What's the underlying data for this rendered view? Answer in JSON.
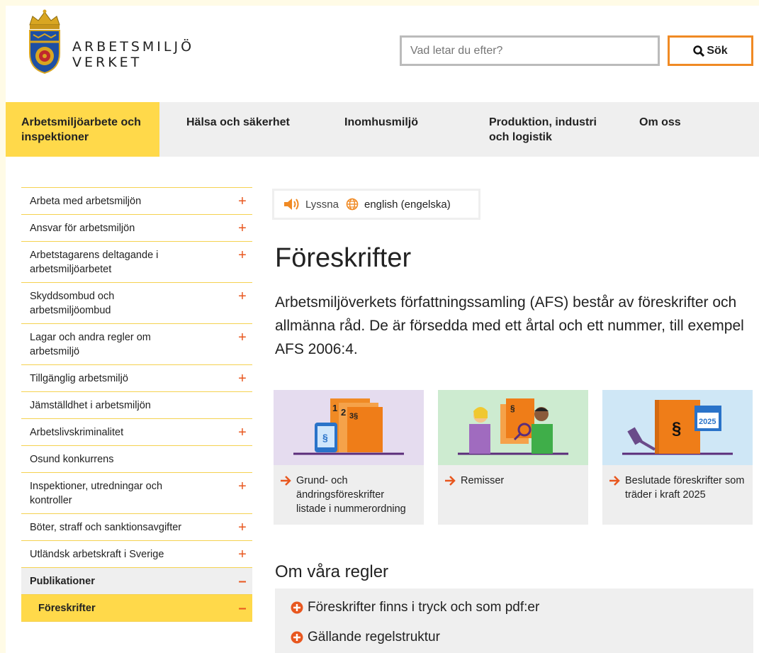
{
  "logo": {
    "line1": "ARBETSMILJÖ",
    "line2": "VERKET",
    "icon": "coat-of-arms-icon"
  },
  "search": {
    "placeholder": "Vad letar du efter?",
    "button_label": "Sök"
  },
  "nav": [
    {
      "label": "Arbetsmiljöarbete och inspektioner",
      "active": true
    },
    {
      "label": "Hälsa och säkerhet"
    },
    {
      "label": "Inomhusmiljö"
    },
    {
      "label": "Produktion, industri och logistik"
    },
    {
      "label": "Om oss"
    }
  ],
  "sidebar": [
    {
      "label": "Arbeta med arbetsmiljön",
      "sign": "+"
    },
    {
      "label": "Ansvar för arbetsmiljön",
      "sign": "+"
    },
    {
      "label": "Arbetstagarens deltagande i arbetsmiljöarbetet",
      "sign": "+"
    },
    {
      "label": "Skyddsombud och arbetsmiljöombud",
      "sign": "+"
    },
    {
      "label": "Lagar och andra regler om arbetsmiljö",
      "sign": "+"
    },
    {
      "label": "Tillgänglig arbetsmiljö",
      "sign": "+"
    },
    {
      "label": "Jämställdhet i arbetsmiljön",
      "sign": ""
    },
    {
      "label": "Arbetslivskriminalitet",
      "sign": "+"
    },
    {
      "label": "Osund konkurrens",
      "sign": ""
    },
    {
      "label": "Inspektioner, utredningar och kontroller",
      "sign": "+"
    },
    {
      "label": "Böter, straff och sanktionsavgifter",
      "sign": "+"
    },
    {
      "label": "Utländsk arbetskraft i Sverige",
      "sign": "+"
    },
    {
      "label": "Publikationer",
      "sign": "–"
    },
    {
      "label": "Föreskrifter",
      "sign": "–"
    }
  ],
  "tools": {
    "listen": "Lyssna",
    "english": "english (engelska)"
  },
  "main": {
    "title": "Föreskrifter",
    "intro": "Arbetsmiljöverkets författningssamling (AFS) består av föreskrifter och allmänna råd. De är försedda med ett årtal och ett nummer, till exempel AFS 2006:4.",
    "cards": [
      {
        "label": "Grund- och ändringsföreskrifter listade i nummerordning",
        "bg": "#e5dcef"
      },
      {
        "label": "Remisser",
        "bg": "#cdebd0"
      },
      {
        "label": "Beslutade föreskrifter som träder i kraft 2025",
        "bg": "#cfe7f6",
        "year": "2025"
      }
    ],
    "card_numbers": {
      "n1": "1",
      "n2": "2",
      "n3": "3§",
      "para": "§"
    },
    "subtitle": "Om våra regler",
    "accordion": [
      "Föreskrifter finns i tryck och som pdf:er",
      "Gällande regelstruktur"
    ]
  },
  "colors": {
    "accent": "#ffd94a",
    "orange": "#f08a24",
    "sign": "#e8571f"
  }
}
